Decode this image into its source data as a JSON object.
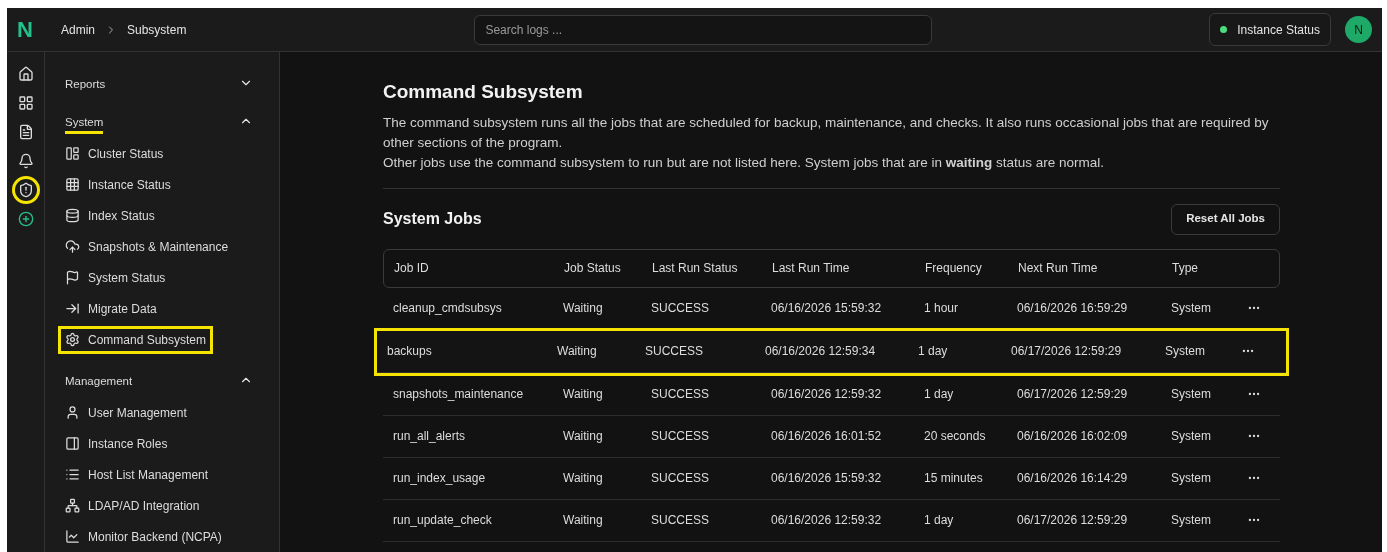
{
  "breadcrumb": [
    "Admin",
    "Subsystem"
  ],
  "search": {
    "placeholder": "Search logs ..."
  },
  "instance_status": {
    "label": "Instance Status",
    "color": "#4ade80"
  },
  "avatar": "N",
  "logo": "N",
  "rail": [
    {
      "highlighted": false
    },
    {
      "highlighted": false
    },
    {
      "highlighted": false
    },
    {
      "highlighted": false
    },
    {
      "highlighted": true
    },
    {
      "highlighted": false
    }
  ],
  "sidebar": [
    {
      "title": "Reports",
      "expanded": false,
      "underlined": false
    },
    {
      "title": "System",
      "expanded": true,
      "underlined": true,
      "items": [
        {
          "label": "Cluster Status",
          "highlighted": false
        },
        {
          "label": "Instance Status",
          "highlighted": false
        },
        {
          "label": "Index Status",
          "highlighted": false
        },
        {
          "label": "Snapshots & Maintenance",
          "highlighted": false
        },
        {
          "label": "System Status",
          "highlighted": false
        },
        {
          "label": "Migrate Data",
          "highlighted": false
        },
        {
          "label": "Command Subsystem",
          "highlighted": true
        }
      ]
    },
    {
      "title": "Management",
      "expanded": true,
      "underlined": false,
      "items": [
        {
          "label": "User Management",
          "highlighted": false
        },
        {
          "label": "Instance Roles",
          "highlighted": false
        },
        {
          "label": "Host List Management",
          "highlighted": false
        },
        {
          "label": "LDAP/AD Integration",
          "highlighted": false
        },
        {
          "label": "Monitor Backend (NCPA)",
          "highlighted": false
        }
      ]
    }
  ],
  "page": {
    "title": "Command Subsystem",
    "description": [
      "The command subsystem runs all the jobs that are scheduled for backup, maintenance, and checks. It also runs occasional jobs that are required by other sections of the program.",
      "Other jobs use the command subsystem to run but are not listed here. System jobs that are in **waiting** status are normal."
    ]
  },
  "jobs": {
    "title": "System Jobs",
    "reset_button": "Reset All Jobs",
    "columns": [
      "Job ID",
      "Job Status",
      "Last Run Status",
      "Last Run Time",
      "Frequency",
      "Next Run Time",
      "Type"
    ],
    "rows": [
      {
        "cells": [
          "cleanup_cmdsubsys",
          "Waiting",
          "SUCCESS",
          "06/16/2026 15:59:32",
          "1 hour",
          "06/16/2026 16:59:29",
          "System"
        ],
        "highlighted": false
      },
      {
        "cells": [
          "backups",
          "Waiting",
          "SUCCESS",
          "06/16/2026 12:59:34",
          "1 day",
          "06/17/2026 12:59:29",
          "System"
        ],
        "highlighted": true
      },
      {
        "cells": [
          "snapshots_maintenance",
          "Waiting",
          "SUCCESS",
          "06/16/2026 12:59:32",
          "1 day",
          "06/17/2026 12:59:29",
          "System"
        ],
        "highlighted": false
      },
      {
        "cells": [
          "run_all_alerts",
          "Waiting",
          "SUCCESS",
          "06/16/2026 16:01:52",
          "20 seconds",
          "06/16/2026 16:02:09",
          "System"
        ],
        "highlighted": false
      },
      {
        "cells": [
          "run_index_usage",
          "Waiting",
          "SUCCESS",
          "06/16/2026 15:59:32",
          "15 minutes",
          "06/16/2026 16:14:29",
          "System"
        ],
        "highlighted": false
      },
      {
        "cells": [
          "run_update_check",
          "Waiting",
          "SUCCESS",
          "06/16/2026 12:59:32",
          "1 day",
          "06/17/2026 12:59:29",
          "System"
        ],
        "highlighted": false
      }
    ]
  }
}
